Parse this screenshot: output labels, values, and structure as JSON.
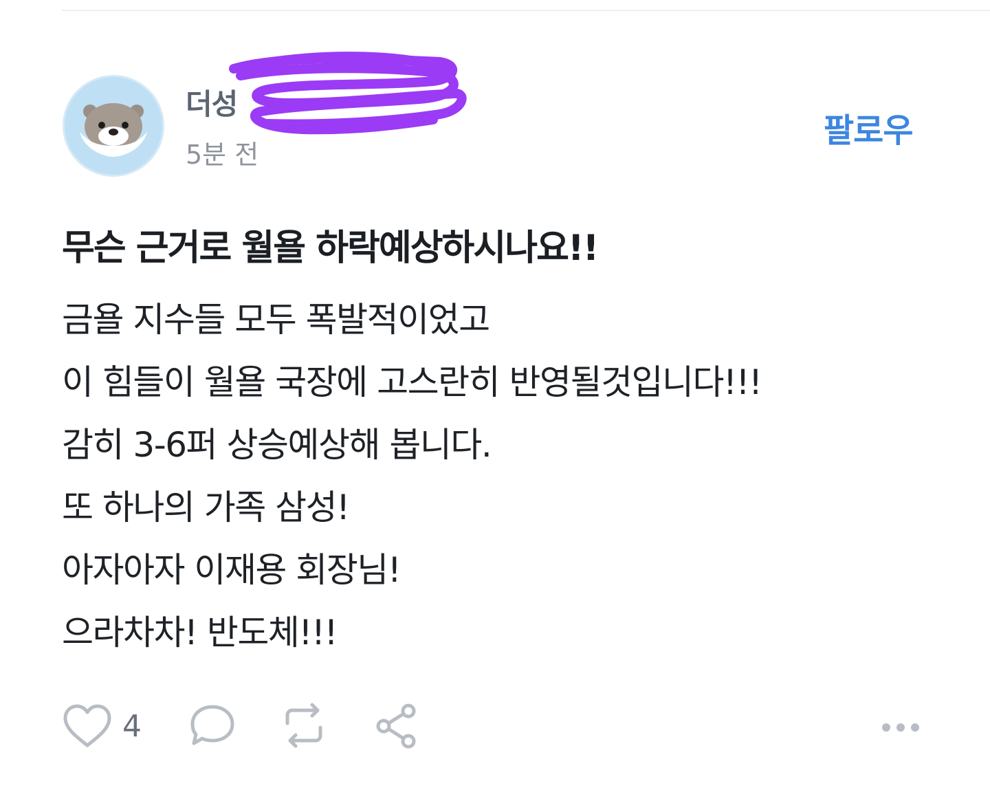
{
  "post": {
    "author_name": "더성",
    "time": "5분 전",
    "follow_label": "팔로우",
    "title": "무슨 근거로 월욜 하락예상하시나요!!",
    "body_lines": [
      "금욜 지수들 모두 폭발적이었고",
      "이 힘들이 월욜 국장에 고스란히 반영될것입니다!!!",
      "감히 3-6퍼 상승예상해 봅니다.",
      "또 하나의 가족 삼성!",
      "아자아자 이재용 회장님!",
      "으라차차! 반도체!!!"
    ]
  },
  "actions": {
    "like_count": "4",
    "icons": [
      "heart-icon",
      "comment-icon",
      "repost-icon",
      "share-icon",
      "more-icon"
    ]
  },
  "colors": {
    "accent": "#3d86e0",
    "redaction": "#9b3bf5",
    "icon": "#b8bdc4"
  }
}
